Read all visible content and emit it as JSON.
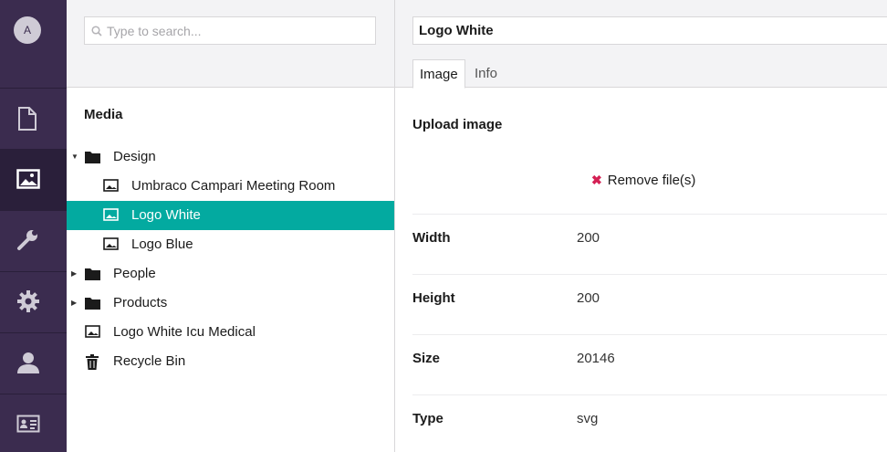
{
  "user": {
    "initial": "A"
  },
  "sections": [
    {
      "name": "content",
      "icon": "document-icon",
      "active": false
    },
    {
      "name": "media",
      "icon": "image-icon",
      "active": true
    },
    {
      "name": "settings",
      "icon": "wrench-icon",
      "active": false
    },
    {
      "name": "developer",
      "icon": "gear-icon",
      "active": false
    },
    {
      "name": "users",
      "icon": "user-icon",
      "active": false
    },
    {
      "name": "members",
      "icon": "id-card-icon",
      "active": false
    }
  ],
  "search": {
    "placeholder": "Type to search..."
  },
  "tree": {
    "root": "Media",
    "nodes": [
      {
        "label": "Design",
        "type": "folder",
        "expanded": true
      },
      {
        "label": "Umbraco Campari Meeting Room",
        "type": "image"
      },
      {
        "label": "Logo White",
        "type": "image",
        "selected": true
      },
      {
        "label": "Logo Blue",
        "type": "image"
      },
      {
        "label": "People",
        "type": "folder",
        "expanded": false
      },
      {
        "label": "Products",
        "type": "folder",
        "expanded": false
      },
      {
        "label": "Logo White Icu Medical",
        "type": "image"
      },
      {
        "label": "Recycle Bin",
        "type": "trash"
      }
    ]
  },
  "editor": {
    "name": "Logo White",
    "tabs": [
      "Image",
      "Info"
    ],
    "upload_label": "Upload image",
    "remove_label": "Remove file(s)",
    "props": [
      {
        "key": "Width",
        "value": "200"
      },
      {
        "key": "Height",
        "value": "200"
      },
      {
        "key": "Size",
        "value": "20146"
      },
      {
        "key": "Type",
        "value": "svg"
      }
    ]
  },
  "colors": {
    "nav_bg": "#3b2c4f",
    "selected": "#03aaa0",
    "danger": "#d42054"
  }
}
